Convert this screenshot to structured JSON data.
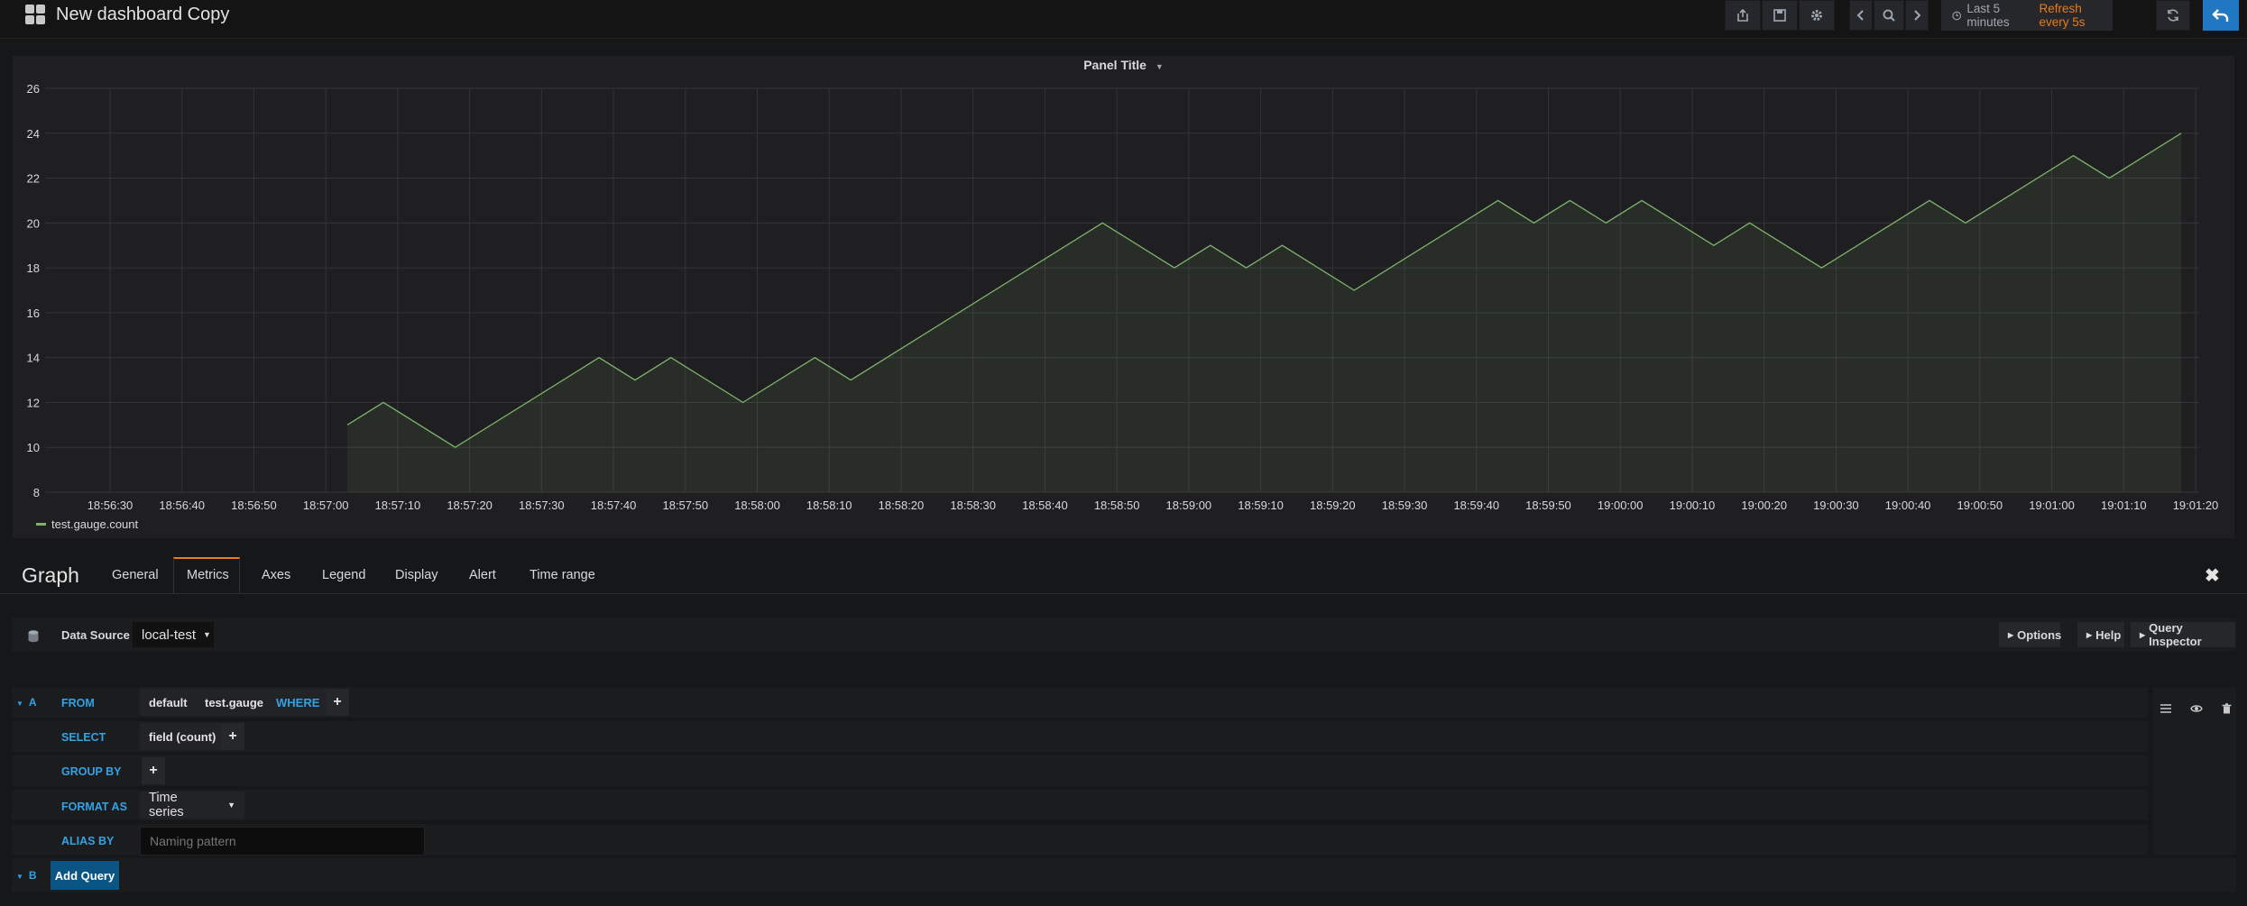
{
  "navbar": {
    "title": "New dashboard Copy",
    "time_range": "Last 5 minutes",
    "refresh": "Refresh every 5s"
  },
  "panel": {
    "title": "Panel Title"
  },
  "chart_data": {
    "type": "area",
    "x_ticks": [
      "18:56:30",
      "18:56:40",
      "18:56:50",
      "18:57:00",
      "18:57:10",
      "18:57:20",
      "18:57:30",
      "18:57:40",
      "18:57:50",
      "18:58:00",
      "18:58:10",
      "18:58:20",
      "18:58:30",
      "18:58:40",
      "18:58:50",
      "18:59:00",
      "18:59:10",
      "18:59:20",
      "18:59:30",
      "18:59:40",
      "18:59:50",
      "19:00:00",
      "19:00:10",
      "19:00:20",
      "19:00:30",
      "19:00:40",
      "19:00:50",
      "19:01:00",
      "19:01:10",
      "19:01:20"
    ],
    "ylim": [
      8,
      26
    ],
    "y_ticks": [
      8,
      10,
      12,
      14,
      16,
      18,
      20,
      22,
      24,
      26
    ],
    "grid": true,
    "legend": "bottom-left",
    "colors": {
      "series": "#7eb26d"
    },
    "series": [
      {
        "name": "test.gauge.count",
        "x": [
          "18:57:03",
          "18:57:08",
          "18:57:18",
          "18:57:38",
          "18:57:43",
          "18:57:48",
          "18:57:58",
          "18:58:08",
          "18:58:13",
          "18:58:48",
          "18:58:58",
          "18:59:03",
          "18:59:08",
          "18:59:13",
          "18:59:23",
          "18:59:43",
          "18:59:48",
          "18:59:53",
          "18:59:58",
          "19:00:03",
          "19:00:13",
          "19:00:18",
          "19:00:28",
          "19:00:43",
          "19:00:48",
          "19:01:03",
          "19:01:08",
          "19:01:18"
        ],
        "values": [
          11,
          12,
          10,
          14,
          13,
          14,
          12,
          14,
          13,
          20,
          18,
          19,
          18,
          19,
          17,
          21,
          20,
          21,
          20,
          21,
          19,
          20,
          18,
          21,
          20,
          23,
          22,
          24
        ]
      }
    ]
  },
  "editor": {
    "title": "Graph",
    "tabs": [
      "General",
      "Metrics",
      "Axes",
      "Legend",
      "Display",
      "Alert",
      "Time range"
    ],
    "datasource_label": "Data Source",
    "datasource": "local-test",
    "options": "Options",
    "help": "Help",
    "query_inspector": "Query Inspector"
  },
  "query": {
    "letter_a": "A",
    "letter_b": "B",
    "from_kw": "FROM",
    "from_policy": "default",
    "from_measurement": "test.gauge",
    "where_kw": "WHERE",
    "select_kw": "SELECT",
    "select_field": "field (count)",
    "group_kw": "GROUP BY",
    "format_kw": "FORMAT AS",
    "format_value": "Time series",
    "alias_kw": "ALIAS BY",
    "alias_placeholder": "Naming pattern",
    "add_query": "Add Query"
  }
}
